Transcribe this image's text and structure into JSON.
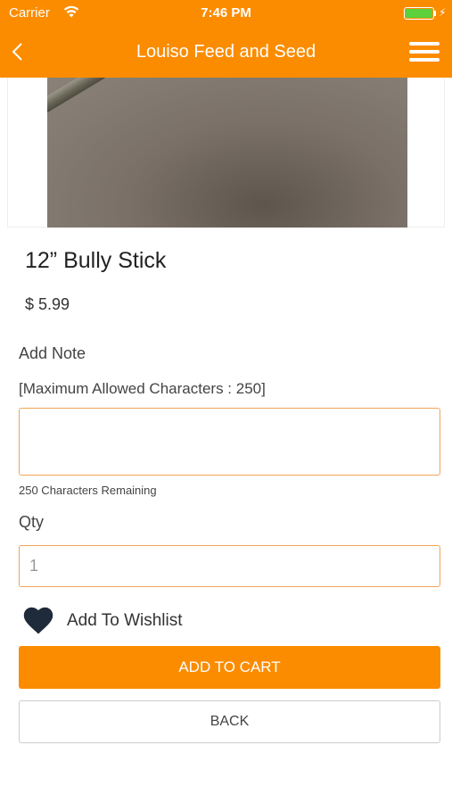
{
  "status_bar": {
    "carrier": "Carrier",
    "time": "7:46 PM",
    "battery_level": 1.0,
    "charging_glyph": "⚡"
  },
  "nav": {
    "title": "Louiso Feed and Seed",
    "back_icon": "chevron-left-icon",
    "menu_icon": "hamburger-menu-icon"
  },
  "product": {
    "name": "12” Bully Stick",
    "price": "$ 5.99"
  },
  "note": {
    "label": "Add Note",
    "limit_text": "[Maximum Allowed Characters : 250]",
    "value": "",
    "remaining_text": "250 Characters Remaining"
  },
  "qty": {
    "label": "Qty",
    "placeholder": "1"
  },
  "wishlist": {
    "label": "Add To Wishlist",
    "icon": "heart-icon"
  },
  "buttons": {
    "add_to_cart": "ADD TO CART",
    "back": "BACK"
  },
  "colors": {
    "accent": "#fb8c00",
    "input_border": "#f0a458",
    "heart": "#1f2a3a",
    "battery": "#5cd13b"
  }
}
